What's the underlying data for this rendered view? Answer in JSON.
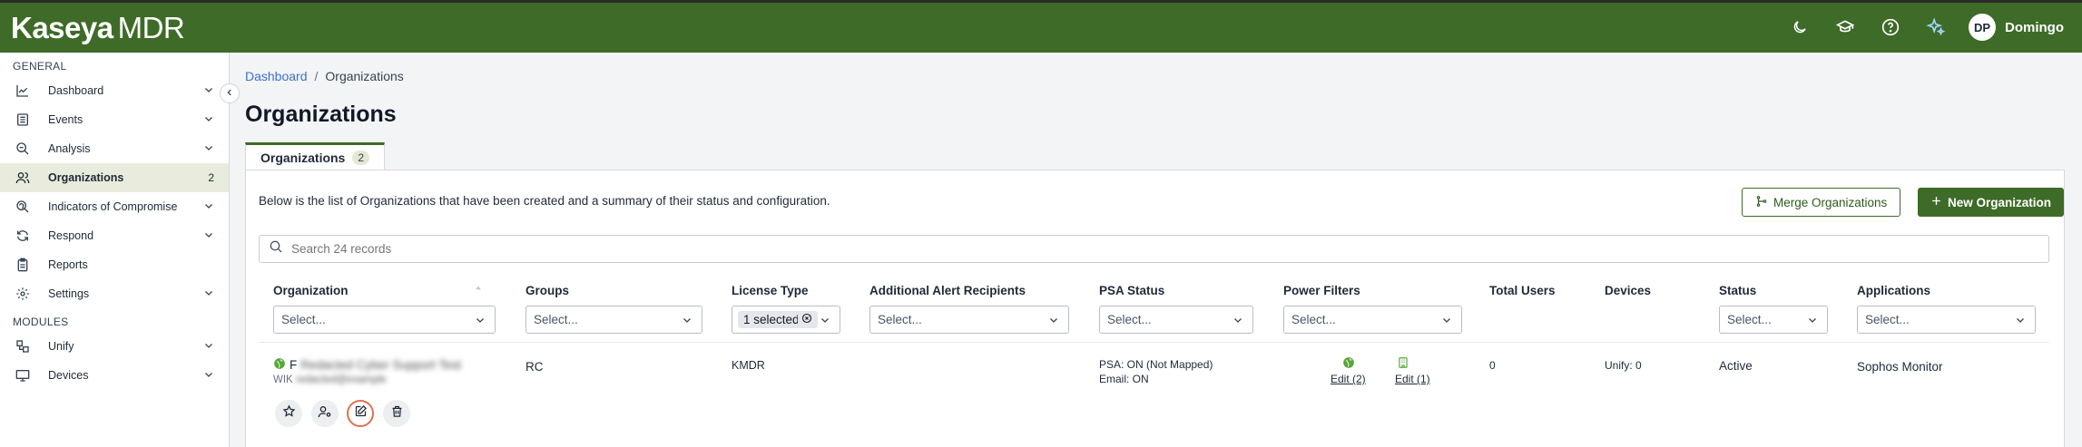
{
  "app": {
    "logo_brand": "Kaseya",
    "logo_product": "MDR"
  },
  "user": {
    "initials": "DP",
    "name": "Domingo"
  },
  "colors": {
    "topbar": "#3e6b27",
    "accent": "#3e6b27",
    "link": "#3b6fd1",
    "highlight": "#e0704f"
  },
  "sidebar": {
    "general_label": "GENERAL",
    "modules_label": "MODULES",
    "general_items": [
      {
        "label": "Dashboard",
        "icon": "chart-line-icon"
      },
      {
        "label": "Events",
        "icon": "list-icon"
      },
      {
        "label": "Analysis",
        "icon": "magnifier-icon"
      },
      {
        "label": "Organizations",
        "icon": "users-icon",
        "count": "2"
      },
      {
        "label": "Indicators of Compromise",
        "icon": "fingerprint-icon"
      },
      {
        "label": "Respond",
        "icon": "refresh-icon"
      },
      {
        "label": "Reports",
        "icon": "clipboard-icon"
      },
      {
        "label": "Settings",
        "icon": "gear-icon"
      }
    ],
    "module_items": [
      {
        "label": "Unify",
        "icon": "network-icon"
      },
      {
        "label": "Devices",
        "icon": "monitor-icon"
      }
    ]
  },
  "breadcrumb": {
    "root": "Dashboard",
    "sep": "/",
    "current": "Organizations"
  },
  "page": {
    "title": "Organizations"
  },
  "tab": {
    "label": "Organizations",
    "count": "2"
  },
  "card": {
    "description": "Below is the list of Organizations that have been created and a summary of their status and configuration.",
    "merge_label": "Merge Organizations",
    "new_label": "New Organization",
    "search_placeholder": "Search 24 records"
  },
  "columns": {
    "organization": "Organization",
    "groups": "Groups",
    "license": "License Type",
    "alert": "Additional Alert Recipients",
    "psa": "PSA Status",
    "power": "Power Filters",
    "users": "Total Users",
    "devices": "Devices",
    "status": "Status",
    "apps": "Applications"
  },
  "filters": {
    "select": "Select...",
    "license_chip": "1 selected"
  },
  "row": {
    "org_name": "Redacted Cyber Support Test",
    "org_name_initial": "F",
    "org_sub": "WIK",
    "org_sub_blur": "redacted@example",
    "groups": "RC",
    "license": "KMDR",
    "psa_line1": "PSA: ON (Not Mapped)",
    "psa_line2": "Email: ON",
    "power_edit1": "Edit (2)",
    "power_edit2": "Edit (1)",
    "users": "0",
    "devices": "Unify: 0",
    "status": "Active",
    "apps": "Sophos Monitor"
  }
}
